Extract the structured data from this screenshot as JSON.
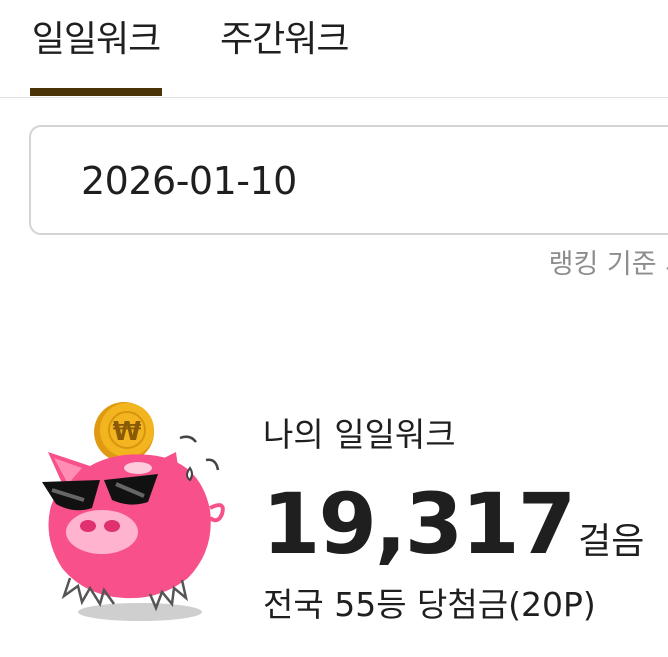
{
  "tabs": {
    "daily_label": "일일워크",
    "weekly_label": "주간워크",
    "active": "일일워크"
  },
  "date_field": {
    "value": "2026-01-10"
  },
  "ranking_note": "랭킹 기준 시",
  "my_walk": {
    "title": "나의 일일워크",
    "steps": "19,317",
    "steps_unit": "걸음",
    "rank_text": "전국 55등 당첨금(20P)"
  },
  "mascot": {
    "icon": "piggy-bank-with-sunglasses-icon",
    "coin_symbol": "₩"
  },
  "colors": {
    "tab_underline": "#4a3407",
    "pig_pink": "#f7508a",
    "coin_gold": "#f2b51f",
    "hint_text": "#8d8d8d"
  }
}
